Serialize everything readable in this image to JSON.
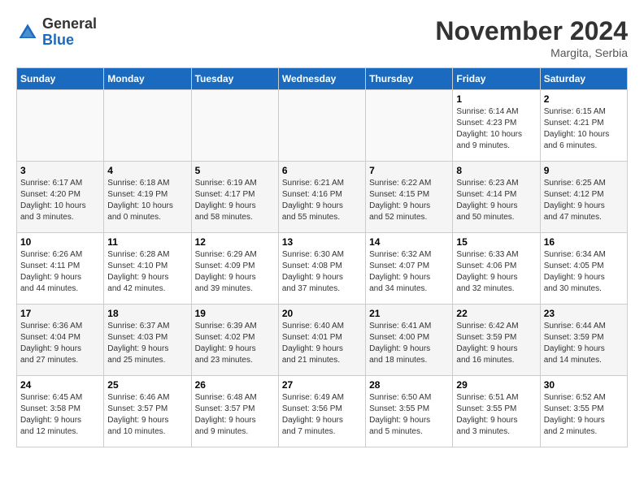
{
  "header": {
    "logo": {
      "general": "General",
      "blue": "Blue"
    },
    "title": "November 2024",
    "subtitle": "Margita, Serbia"
  },
  "weekdays": [
    "Sunday",
    "Monday",
    "Tuesday",
    "Wednesday",
    "Thursday",
    "Friday",
    "Saturday"
  ],
  "weeks": [
    [
      {
        "day": "",
        "info": ""
      },
      {
        "day": "",
        "info": ""
      },
      {
        "day": "",
        "info": ""
      },
      {
        "day": "",
        "info": ""
      },
      {
        "day": "",
        "info": ""
      },
      {
        "day": "1",
        "info": "Sunrise: 6:14 AM\nSunset: 4:23 PM\nDaylight: 10 hours\nand 9 minutes."
      },
      {
        "day": "2",
        "info": "Sunrise: 6:15 AM\nSunset: 4:21 PM\nDaylight: 10 hours\nand 6 minutes."
      }
    ],
    [
      {
        "day": "3",
        "info": "Sunrise: 6:17 AM\nSunset: 4:20 PM\nDaylight: 10 hours\nand 3 minutes."
      },
      {
        "day": "4",
        "info": "Sunrise: 6:18 AM\nSunset: 4:19 PM\nDaylight: 10 hours\nand 0 minutes."
      },
      {
        "day": "5",
        "info": "Sunrise: 6:19 AM\nSunset: 4:17 PM\nDaylight: 9 hours\nand 58 minutes."
      },
      {
        "day": "6",
        "info": "Sunrise: 6:21 AM\nSunset: 4:16 PM\nDaylight: 9 hours\nand 55 minutes."
      },
      {
        "day": "7",
        "info": "Sunrise: 6:22 AM\nSunset: 4:15 PM\nDaylight: 9 hours\nand 52 minutes."
      },
      {
        "day": "8",
        "info": "Sunrise: 6:23 AM\nSunset: 4:14 PM\nDaylight: 9 hours\nand 50 minutes."
      },
      {
        "day": "9",
        "info": "Sunrise: 6:25 AM\nSunset: 4:12 PM\nDaylight: 9 hours\nand 47 minutes."
      }
    ],
    [
      {
        "day": "10",
        "info": "Sunrise: 6:26 AM\nSunset: 4:11 PM\nDaylight: 9 hours\nand 44 minutes."
      },
      {
        "day": "11",
        "info": "Sunrise: 6:28 AM\nSunset: 4:10 PM\nDaylight: 9 hours\nand 42 minutes."
      },
      {
        "day": "12",
        "info": "Sunrise: 6:29 AM\nSunset: 4:09 PM\nDaylight: 9 hours\nand 39 minutes."
      },
      {
        "day": "13",
        "info": "Sunrise: 6:30 AM\nSunset: 4:08 PM\nDaylight: 9 hours\nand 37 minutes."
      },
      {
        "day": "14",
        "info": "Sunrise: 6:32 AM\nSunset: 4:07 PM\nDaylight: 9 hours\nand 34 minutes."
      },
      {
        "day": "15",
        "info": "Sunrise: 6:33 AM\nSunset: 4:06 PM\nDaylight: 9 hours\nand 32 minutes."
      },
      {
        "day": "16",
        "info": "Sunrise: 6:34 AM\nSunset: 4:05 PM\nDaylight: 9 hours\nand 30 minutes."
      }
    ],
    [
      {
        "day": "17",
        "info": "Sunrise: 6:36 AM\nSunset: 4:04 PM\nDaylight: 9 hours\nand 27 minutes."
      },
      {
        "day": "18",
        "info": "Sunrise: 6:37 AM\nSunset: 4:03 PM\nDaylight: 9 hours\nand 25 minutes."
      },
      {
        "day": "19",
        "info": "Sunrise: 6:39 AM\nSunset: 4:02 PM\nDaylight: 9 hours\nand 23 minutes."
      },
      {
        "day": "20",
        "info": "Sunrise: 6:40 AM\nSunset: 4:01 PM\nDaylight: 9 hours\nand 21 minutes."
      },
      {
        "day": "21",
        "info": "Sunrise: 6:41 AM\nSunset: 4:00 PM\nDaylight: 9 hours\nand 18 minutes."
      },
      {
        "day": "22",
        "info": "Sunrise: 6:42 AM\nSunset: 3:59 PM\nDaylight: 9 hours\nand 16 minutes."
      },
      {
        "day": "23",
        "info": "Sunrise: 6:44 AM\nSunset: 3:59 PM\nDaylight: 9 hours\nand 14 minutes."
      }
    ],
    [
      {
        "day": "24",
        "info": "Sunrise: 6:45 AM\nSunset: 3:58 PM\nDaylight: 9 hours\nand 12 minutes."
      },
      {
        "day": "25",
        "info": "Sunrise: 6:46 AM\nSunset: 3:57 PM\nDaylight: 9 hours\nand 10 minutes."
      },
      {
        "day": "26",
        "info": "Sunrise: 6:48 AM\nSunset: 3:57 PM\nDaylight: 9 hours\nand 9 minutes."
      },
      {
        "day": "27",
        "info": "Sunrise: 6:49 AM\nSunset: 3:56 PM\nDaylight: 9 hours\nand 7 minutes."
      },
      {
        "day": "28",
        "info": "Sunrise: 6:50 AM\nSunset: 3:55 PM\nDaylight: 9 hours\nand 5 minutes."
      },
      {
        "day": "29",
        "info": "Sunrise: 6:51 AM\nSunset: 3:55 PM\nDaylight: 9 hours\nand 3 minutes."
      },
      {
        "day": "30",
        "info": "Sunrise: 6:52 AM\nSunset: 3:55 PM\nDaylight: 9 hours\nand 2 minutes."
      }
    ]
  ]
}
